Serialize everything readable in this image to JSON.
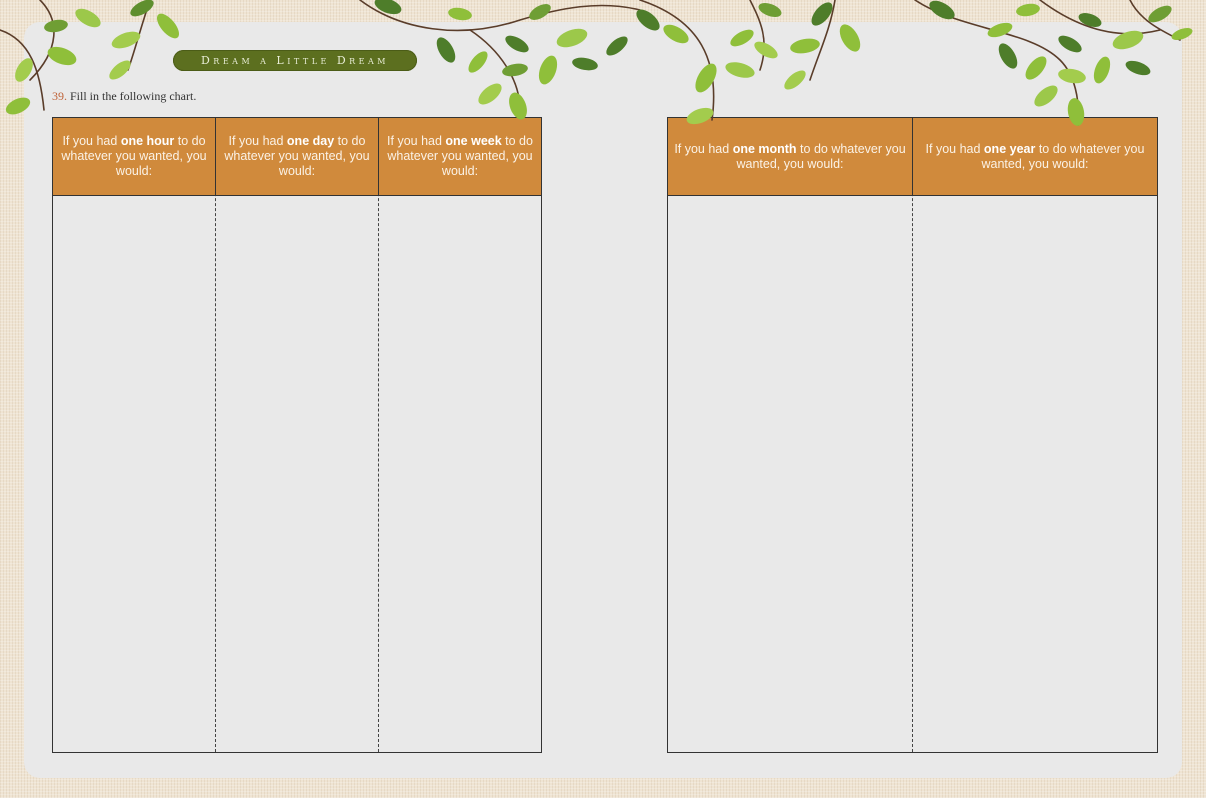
{
  "banner": {
    "title": "Dream a Little Dream"
  },
  "instruction": {
    "number": "39.",
    "text": " Fill in the following chart."
  },
  "left_table": {
    "columns": [
      {
        "pre": "If you had ",
        "bold": "one hour",
        "post": " to do whatever you wanted, you would:"
      },
      {
        "pre": "If you had ",
        "bold": "one day",
        "post": " to do whatever you wanted, you would:"
      },
      {
        "pre": "If you had ",
        "bold": "one week",
        "post": " to do whatever you wanted, you would:"
      }
    ]
  },
  "right_table": {
    "columns": [
      {
        "pre": "If you had ",
        "bold": "one month",
        "post": " to do whatever you wanted, you would:"
      },
      {
        "pre": "If you had ",
        "bold": "one year",
        "post": " to do whatever you wanted, you would:"
      }
    ]
  },
  "colors": {
    "header_fill": "#d08a3c",
    "banner_fill": "#5c6f1f",
    "page_fill": "#e9e9e9",
    "leaf_light": "#8fbf3a",
    "leaf_dark": "#4e7d2a"
  },
  "decoration": {
    "icon": "vine-leaves-icon"
  }
}
